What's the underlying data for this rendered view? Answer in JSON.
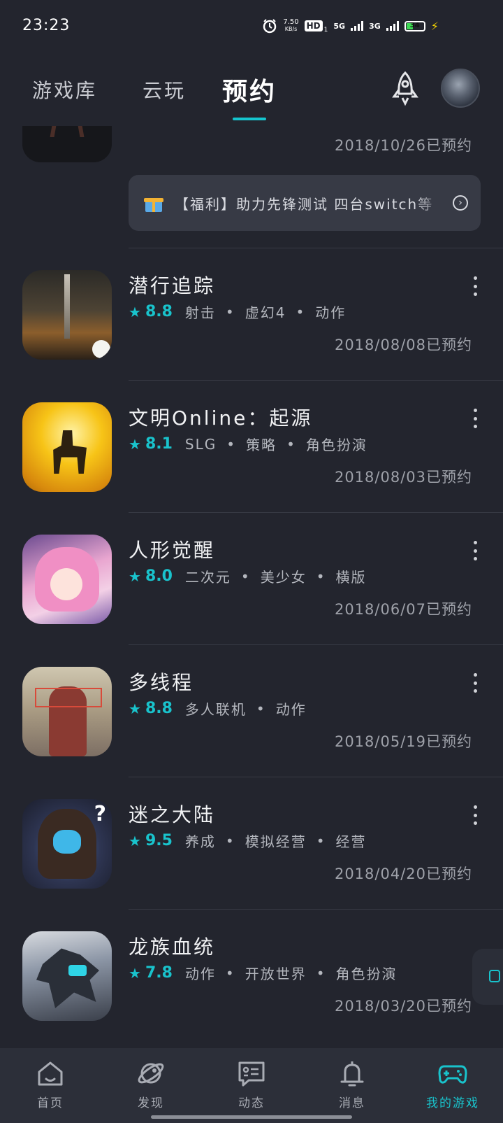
{
  "status_bar": {
    "time": "23:23",
    "net_speed_value": "7.50",
    "net_speed_unit": "KB/s",
    "hd_label": "HD",
    "hd_sub": "1",
    "net_1": "5G",
    "net_2": "3G",
    "battery": "34"
  },
  "header": {
    "tabs": [
      {
        "label": "游戏库"
      },
      {
        "label": "云玩"
      },
      {
        "label": "预约"
      }
    ],
    "active_tab_index": 2,
    "accent_color": "#15c5ce"
  },
  "list": {
    "partial_date": "2018/10/26已预约",
    "banner_text": "【福利】助力先锋测试 四台switch等",
    "items": [
      {
        "title": "潜行追踪",
        "score": "8.8",
        "tags": [
          "射击",
          "虚幻4",
          "动作"
        ],
        "date": "2018/08/08已预约"
      },
      {
        "title": "文明Online：起源",
        "score": "8.1",
        "tags": [
          "SLG",
          "策略",
          "角色扮演"
        ],
        "date": "2018/08/03已预约"
      },
      {
        "title": "人形觉醒",
        "score": "8.0",
        "tags": [
          "二次元",
          "美少女",
          "横版"
        ],
        "date": "2018/06/07已预约"
      },
      {
        "title": "多线程",
        "score": "8.8",
        "tags": [
          "多人联机",
          "动作"
        ],
        "date": "2018/05/19已预约"
      },
      {
        "title": "迷之大陆",
        "score": "9.5",
        "tags": [
          "养成",
          "模拟经营",
          "经营"
        ],
        "date": "2018/04/20已预约"
      },
      {
        "title": "龙族血统",
        "score": "7.8",
        "tags": [
          "动作",
          "开放世界",
          "角色扮演"
        ],
        "date": "2018/03/20已预约"
      }
    ]
  },
  "bottom_nav": {
    "items": [
      {
        "label": "首页",
        "icon": "home-icon"
      },
      {
        "label": "发现",
        "icon": "planet-icon"
      },
      {
        "label": "动态",
        "icon": "chat-card-icon"
      },
      {
        "label": "消息",
        "icon": "bell-icon"
      },
      {
        "label": "我的游戏",
        "icon": "gamepad-icon"
      }
    ],
    "active_index": 4,
    "active_color": "#19c3cc"
  }
}
